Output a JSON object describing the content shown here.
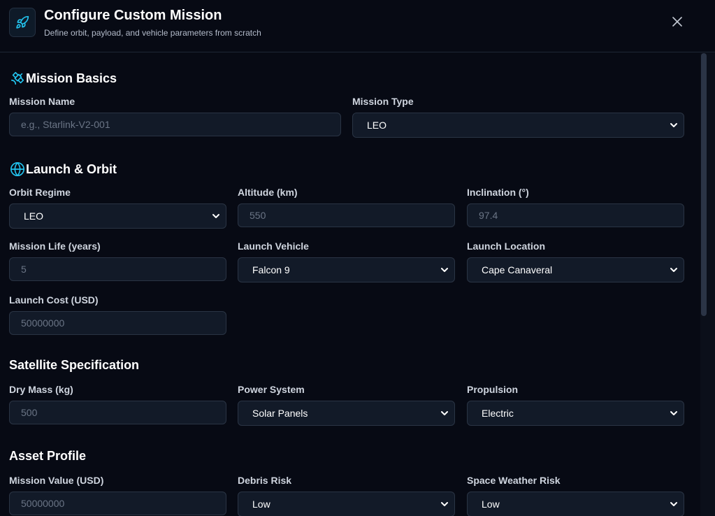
{
  "header": {
    "title": "Configure Custom Mission",
    "subtitle": "Define orbit, payload, and vehicle parameters from scratch",
    "icon": "rocket-icon",
    "close_icon": "close-icon"
  },
  "colors": {
    "background": "#070a14",
    "field_bg": "#121a28",
    "field_border": "#2a3444",
    "accent": "#22c3ee"
  },
  "sections": {
    "basics": {
      "title": "Mission Basics",
      "icon": "satellite-icon",
      "mission_name": {
        "label": "Mission Name",
        "placeholder": "e.g., Starlink-V2-001"
      },
      "mission_type": {
        "label": "Mission Type",
        "value": "LEO"
      }
    },
    "launch": {
      "title": "Launch & Orbit",
      "icon": "globe-icon",
      "orbit_regime": {
        "label": "Orbit Regime",
        "value": "LEO"
      },
      "altitude": {
        "label": "Altitude (km)",
        "placeholder": "550"
      },
      "inclination": {
        "label": "Inclination (°)",
        "placeholder": "97.4"
      },
      "mission_life": {
        "label": "Mission Life (years)",
        "placeholder": "5"
      },
      "launch_vehicle": {
        "label": "Launch Vehicle",
        "value": "Falcon 9"
      },
      "launch_location": {
        "label": "Launch Location",
        "value": "Cape Canaveral"
      },
      "launch_cost": {
        "label": "Launch Cost (USD)",
        "placeholder": "50000000"
      }
    },
    "satellite": {
      "title": "Satellite Specification",
      "dry_mass": {
        "label": "Dry Mass (kg)",
        "placeholder": "500"
      },
      "power_system": {
        "label": "Power System",
        "value": "Solar Panels"
      },
      "propulsion": {
        "label": "Propulsion",
        "value": "Electric"
      }
    },
    "asset": {
      "title": "Asset Profile",
      "mission_value": {
        "label": "Mission Value (USD)",
        "placeholder": "50000000"
      },
      "debris_risk": {
        "label": "Debris Risk",
        "value": "Low"
      },
      "space_weather_risk": {
        "label": "Space Weather Risk",
        "value": "Low"
      }
    }
  }
}
